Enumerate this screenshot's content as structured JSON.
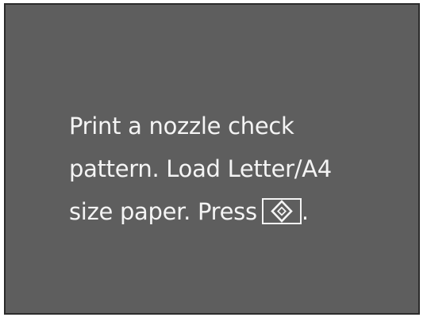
{
  "screen": {
    "line1": "Print a nozzle check",
    "line2": "pattern. Load Letter/A4",
    "line3_prefix": "size paper. Press",
    "line3_suffix": ".",
    "start_icon": "start-diamond-icon"
  },
  "colors": {
    "background": "#5e5e5e",
    "text": "#f4f4f4",
    "border": "#2b2b2b"
  }
}
